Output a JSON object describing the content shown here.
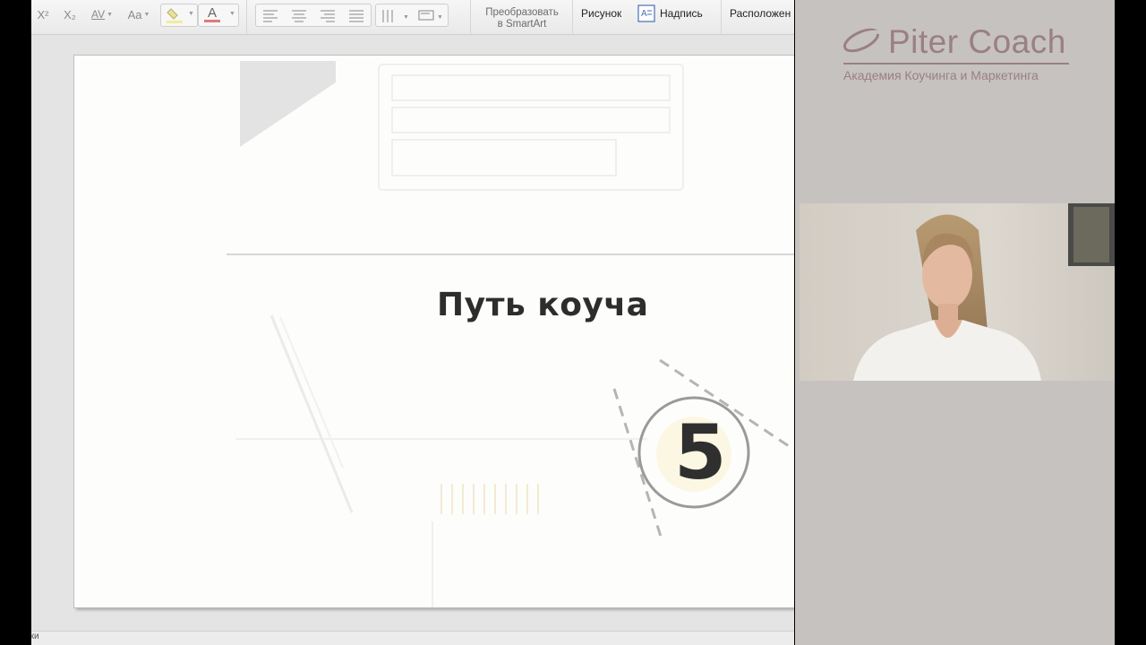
{
  "toolbar": {
    "superscript": "X²",
    "subscript": "X₂",
    "char_spacing": "AV",
    "change_case": "Aa",
    "font_color": "A",
    "convert_smartart_line1": "Преобразовать",
    "convert_smartart_line2": "в SmartArt",
    "picture": "Рисунок",
    "textbox": "Надпись",
    "arrange": "Расположен"
  },
  "slide": {
    "title": "Путь коуча",
    "number": "5"
  },
  "brand": {
    "name": "Piter Coach",
    "tagline": "Академия Коучинга и Маркетинга",
    "color": "#9a7f86"
  },
  "status": {
    "text": "тки"
  }
}
